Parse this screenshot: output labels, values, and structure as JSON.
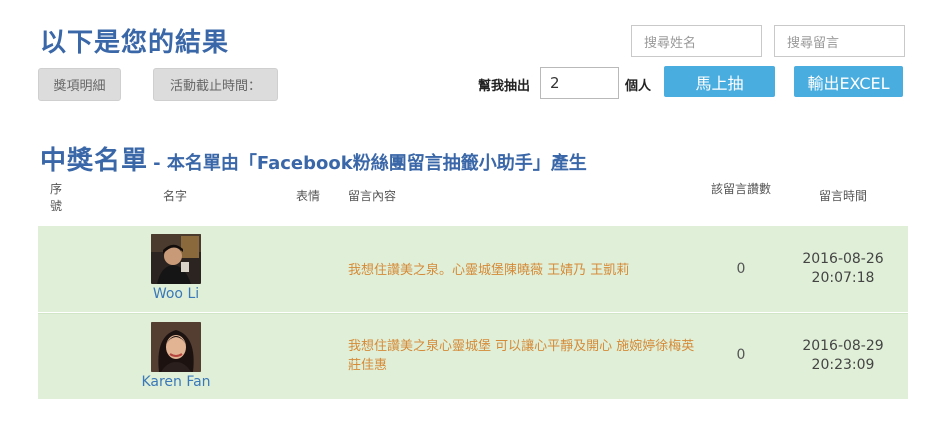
{
  "header": {
    "title": "以下是您的結果",
    "prize_detail_button": "獎項明細",
    "deadline_button": "活動截止時間：",
    "search_name_placeholder": "搜尋姓名",
    "search_message_placeholder": "搜尋留言",
    "draw_label": "幫我抽出",
    "draw_count": "2",
    "draw_unit": "個人",
    "draw_button": "馬上抽",
    "export_button": "輸出EXCEL"
  },
  "winners": {
    "title": "中獎名單",
    "subtitle": "- 本名單由「Facebook粉絲團留言抽籤小助手」產生",
    "columns": {
      "seq": "序號",
      "name": "名字",
      "emotion": "表情",
      "content": "留言內容",
      "likes": "該留言讚數",
      "time": "留言時間"
    },
    "rows": [
      {
        "name": "Woo Li",
        "message": "我想住讚美之泉。心靈城堡陳曉薇 王婧乃 王凱莉",
        "likes": "0",
        "date": "2016-08-26",
        "time": "20:07:18"
      },
      {
        "name": "Karen Fan",
        "message": "我想住讚美之泉心靈城堡 可以讓心平靜及開心 施婉婷徐梅英莊佳惠",
        "likes": "0",
        "date": "2016-08-29",
        "time": "20:23:09"
      }
    ]
  },
  "colors": {
    "title": "#3a67a8",
    "button_blue": "#49ade0",
    "row_bg": "#e0f0d8",
    "message_text": "#d58a38",
    "name_link": "#3a78b8"
  }
}
